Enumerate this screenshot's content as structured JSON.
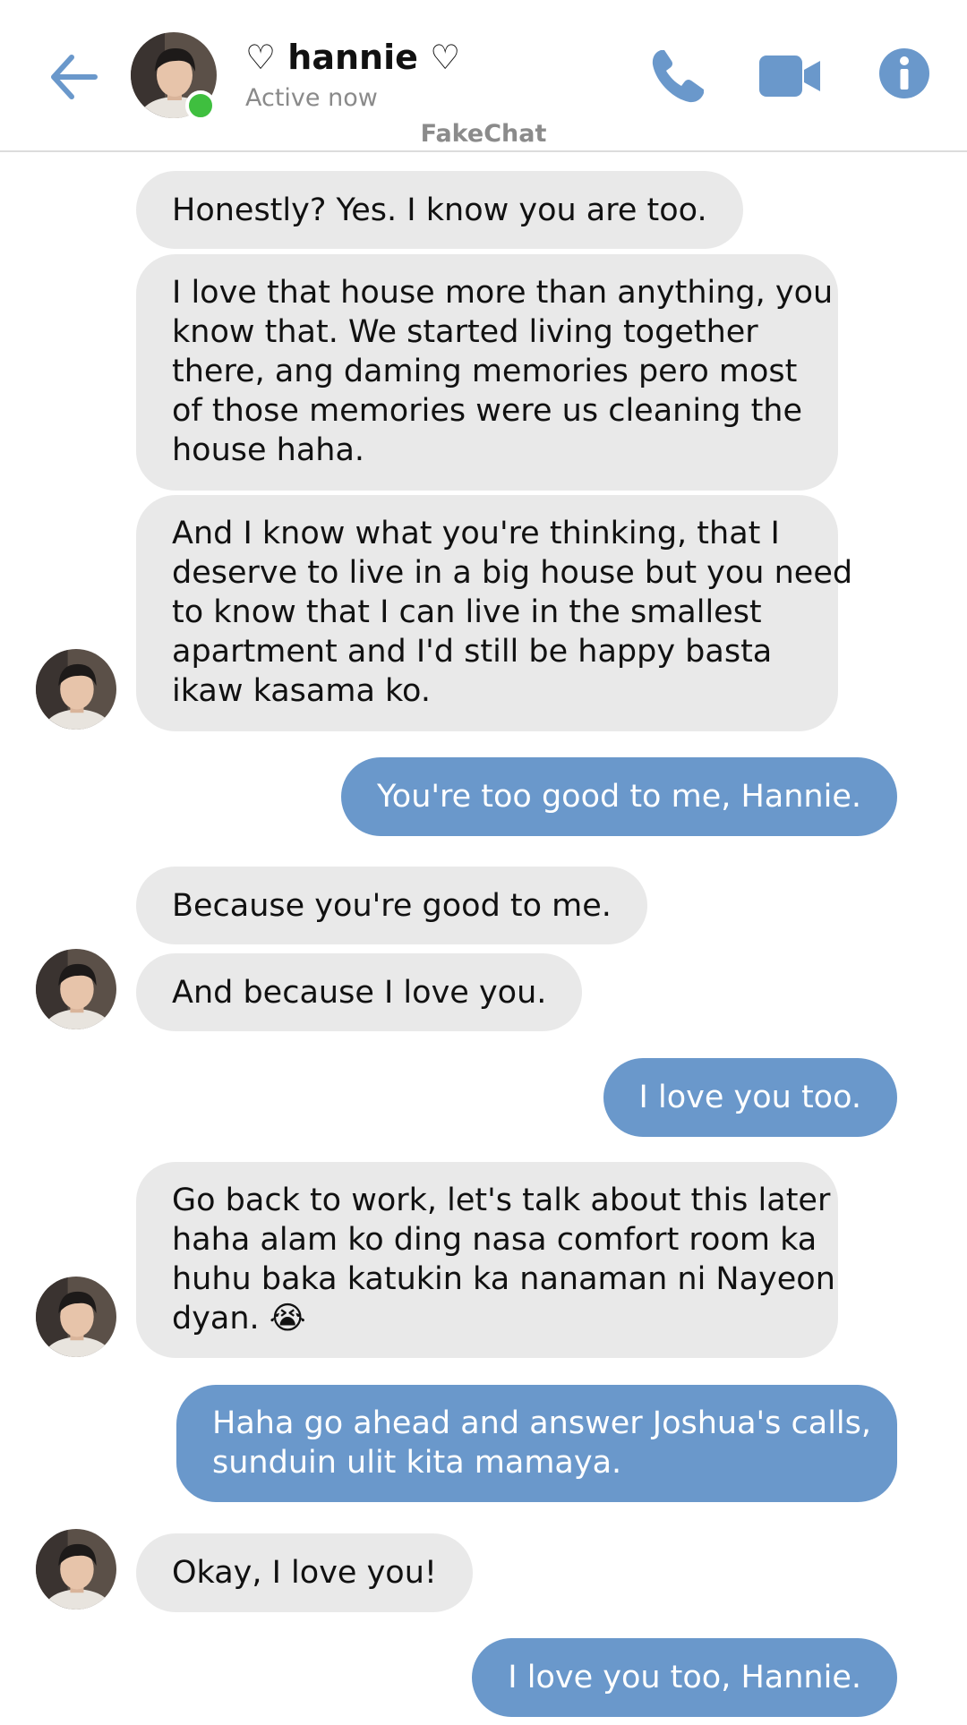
{
  "header": {
    "contact_name": "♡ hannie ♡",
    "status": "Active now",
    "watermark": "FakeChat",
    "accent_color": "#6a98cb",
    "online_color": "#3fbf3f",
    "icons": [
      "back-arrow-icon",
      "phone-icon",
      "video-camera-icon",
      "info-icon"
    ]
  },
  "messages": [
    {
      "from": "contact",
      "lines": [
        "Honestly? Yes. I know you are too."
      ]
    },
    {
      "from": "contact",
      "lines": [
        "I love that house more than anything, you",
        "know that. We started living together",
        "there, ang daming memories pero most",
        "of those memories were us cleaning the",
        "house haha."
      ]
    },
    {
      "from": "contact",
      "lines": [
        "And I know what you're thinking, that I",
        "deserve to live in a big house but you need",
        "to know that I can live in the smallest",
        "apartment and I'd still be happy basta",
        "ikaw kasama ko."
      ]
    },
    {
      "from": "me",
      "lines": [
        "You're too good to me, Hannie."
      ]
    },
    {
      "from": "contact",
      "lines": [
        "Because you're good to me."
      ]
    },
    {
      "from": "contact",
      "lines": [
        "And because I love you."
      ]
    },
    {
      "from": "me",
      "lines": [
        "I love you too."
      ]
    },
    {
      "from": "contact",
      "lines": [
        "Go back to work, let's talk about this later",
        "haha alam ko ding nasa comfort room ka",
        "huhu baka katukin ka nanaman ni Nayeon",
        "dyan. 😭"
      ]
    },
    {
      "from": "me",
      "lines": [
        "Haha go ahead and answer Joshua's calls,",
        "sunduin ulit kita mamaya."
      ]
    },
    {
      "from": "contact",
      "lines": [
        "Okay, I love you!"
      ]
    },
    {
      "from": "me",
      "lines": [
        "I love you too, Hannie."
      ]
    }
  ]
}
